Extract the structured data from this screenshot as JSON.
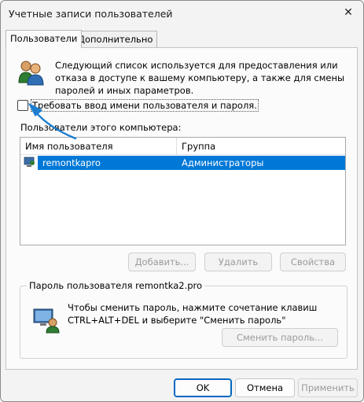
{
  "window": {
    "title": "Учетные записи пользователей",
    "close_glyph": "✕"
  },
  "tabs": [
    {
      "label": "Пользователи",
      "active": true
    },
    {
      "label": "Дополнительно",
      "active": false
    }
  ],
  "intro": {
    "text": "Следующий список используется для предоставления или отказа в доступе к вашему компьютеру, а также для смены паролей и иных параметров.",
    "icon": "users-icon"
  },
  "require_login": {
    "label": "Требовать ввод имени пользователя и пароля.",
    "checked": false
  },
  "users": {
    "label": "Пользователи этого компьютера:",
    "columns": [
      "Имя пользователя",
      "Группа"
    ],
    "rows": [
      {
        "name": "remontkapro",
        "group": "Администраторы",
        "selected": true
      }
    ]
  },
  "buttons": {
    "add": "Добавить...",
    "remove": "Удалить",
    "properties": "Свойства"
  },
  "password": {
    "title": "Пароль пользователя remontka2.pro",
    "text": "Чтобы сменить пароль, нажмите сочетание клавиш CTRL+ALT+DEL и выберите \"Сменить пароль\"",
    "button": "Сменить пароль..."
  },
  "footer": {
    "ok": "OK",
    "cancel": "Отмена",
    "apply": "Применить"
  },
  "colors": {
    "selection": "#0078d7",
    "accent": "#0067c0",
    "annotation_arrow": "#1e7fd0"
  }
}
